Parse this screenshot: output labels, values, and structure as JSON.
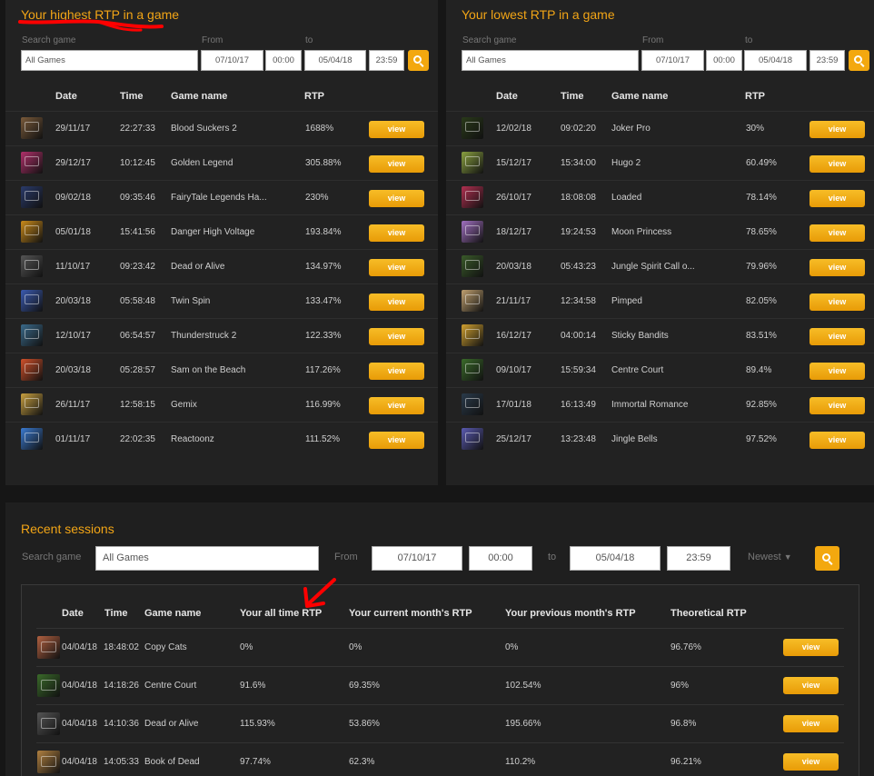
{
  "highest": {
    "title": "Your highest RTP in a game",
    "search_label": "Search game",
    "search_value": "All Games",
    "from_label": "From",
    "from_date": "07/10/17",
    "from_time": "00:00",
    "to_label": "to",
    "to_date": "05/04/18",
    "to_time": "23:59",
    "columns": [
      "Date",
      "Time",
      "Game name",
      "RTP"
    ],
    "view_label": "view",
    "rows": [
      {
        "date": "29/11/17",
        "time": "22:27:33",
        "game": "Blood Suckers 2",
        "rtp": "1688%",
        "color": "#7a5a3a"
      },
      {
        "date": "29/12/17",
        "time": "10:12:45",
        "game": "Golden Legend",
        "rtp": "305.88%",
        "color": "#b0306a"
      },
      {
        "date": "09/02/18",
        "time": "09:35:46",
        "game": "FairyTale Legends Ha...",
        "rtp": "230%",
        "color": "#2a3a6a"
      },
      {
        "date": "05/01/18",
        "time": "15:41:56",
        "game": "Danger High Voltage",
        "rtp": "193.84%",
        "color": "#c98a1a"
      },
      {
        "date": "11/10/17",
        "time": "09:23:42",
        "game": "Dead or Alive",
        "rtp": "134.97%",
        "color": "#555555"
      },
      {
        "date": "20/03/18",
        "time": "05:58:48",
        "game": "Twin Spin",
        "rtp": "133.47%",
        "color": "#3a5ab0"
      },
      {
        "date": "12/10/17",
        "time": "06:54:57",
        "game": "Thunderstruck 2",
        "rtp": "122.33%",
        "color": "#3a6a8a"
      },
      {
        "date": "20/03/18",
        "time": "05:28:57",
        "game": "Sam on the Beach",
        "rtp": "117.26%",
        "color": "#d0502a"
      },
      {
        "date": "26/11/17",
        "time": "12:58:15",
        "game": "Gemix",
        "rtp": "116.99%",
        "color": "#c8a040"
      },
      {
        "date": "01/11/17",
        "time": "22:02:35",
        "game": "Reactoonz",
        "rtp": "111.52%",
        "color": "#3a7ad0"
      }
    ]
  },
  "lowest": {
    "title": "Your lowest RTP in a game",
    "search_label": "Search game",
    "search_value": "All Games",
    "from_label": "From",
    "from_date": "07/10/17",
    "from_time": "00:00",
    "to_label": "to",
    "to_date": "05/04/18",
    "to_time": "23:59",
    "columns": [
      "Date",
      "Time",
      "Game name",
      "RTP"
    ],
    "view_label": "view",
    "rows": [
      {
        "date": "12/02/18",
        "time": "09:02:20",
        "game": "Joker Pro",
        "rtp": "30%",
        "color": "#2a3a1a"
      },
      {
        "date": "15/12/17",
        "time": "15:34:00",
        "game": "Hugo 2",
        "rtp": "60.49%",
        "color": "#8aa040"
      },
      {
        "date": "26/10/17",
        "time": "18:08:08",
        "game": "Loaded",
        "rtp": "78.14%",
        "color": "#b03050"
      },
      {
        "date": "18/12/17",
        "time": "19:24:53",
        "game": "Moon Princess",
        "rtp": "78.65%",
        "color": "#a070c0"
      },
      {
        "date": "20/03/18",
        "time": "05:43:23",
        "game": "Jungle Spirit Call o...",
        "rtp": "79.96%",
        "color": "#3a5a2a"
      },
      {
        "date": "21/11/17",
        "time": "12:34:58",
        "game": "Pimped",
        "rtp": "82.05%",
        "color": "#c0a070"
      },
      {
        "date": "16/12/17",
        "time": "04:00:14",
        "game": "Sticky Bandits",
        "rtp": "83.51%",
        "color": "#d0a030"
      },
      {
        "date": "09/10/17",
        "time": "15:59:34",
        "game": "Centre Court",
        "rtp": "89.4%",
        "color": "#3a6a2a"
      },
      {
        "date": "17/01/18",
        "time": "16:13:49",
        "game": "Immortal Romance",
        "rtp": "92.85%",
        "color": "#2a3a4a"
      },
      {
        "date": "25/12/17",
        "time": "13:23:48",
        "game": "Jingle Bells",
        "rtp": "97.52%",
        "color": "#5a5ab0"
      }
    ]
  },
  "recent": {
    "title": "Recent sessions",
    "search_label": "Search game",
    "search_value": "All Games",
    "from_label": "From",
    "from_date": "07/10/17",
    "from_time": "00:00",
    "to_label": "to",
    "to_date": "05/04/18",
    "to_time": "23:59",
    "sort_label": "Newest",
    "columns": [
      "Date",
      "Time",
      "Game name",
      "Your all time RTP",
      "Your current month's RTP",
      "Your previous month's RTP",
      "Theoretical RTP"
    ],
    "view_label": "view",
    "rows": [
      {
        "date": "04/04/18",
        "time": "18:48:02",
        "game": "Copy Cats",
        "all_time": "0%",
        "current": "0%",
        "previous": "0%",
        "theoretical": "96.76%",
        "color": "#b06040"
      },
      {
        "date": "04/04/18",
        "time": "14:18:26",
        "game": "Centre Court",
        "all_time": "91.6%",
        "current": "69.35%",
        "previous": "102.54%",
        "theoretical": "96%",
        "color": "#3a6a2a"
      },
      {
        "date": "04/04/18",
        "time": "14:10:36",
        "game": "Dead or Alive",
        "all_time": "115.93%",
        "current": "53.86%",
        "previous": "195.66%",
        "theoretical": "96.8%",
        "color": "#555555"
      },
      {
        "date": "04/04/18",
        "time": "14:05:33",
        "game": "Book of Dead",
        "all_time": "97.74%",
        "current": "62.3%",
        "previous": "110.2%",
        "theoretical": "96.21%",
        "color": "#b08040"
      }
    ]
  },
  "colors": {
    "accent": "#f2a516",
    "button": "#f3a80f",
    "annotation": "#ff0000"
  }
}
